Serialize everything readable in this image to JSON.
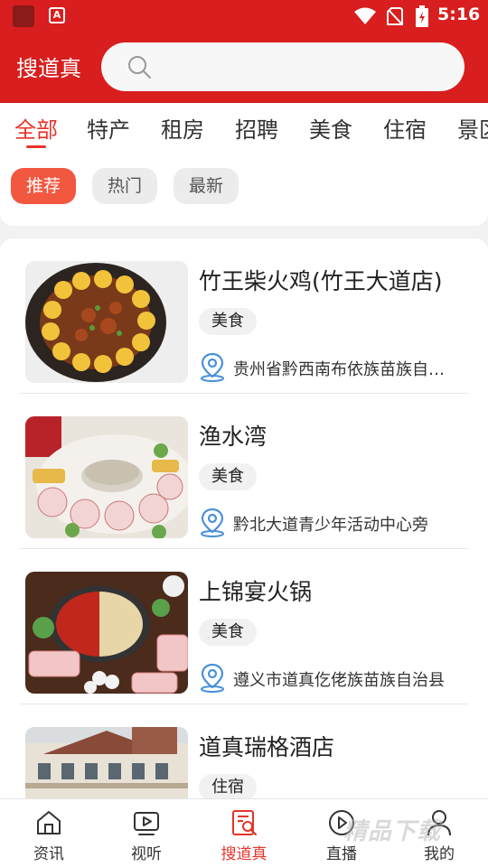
{
  "status_bar": {
    "time": "5:16",
    "notif_glyph": "A"
  },
  "header": {
    "brand": "搜道真",
    "search_placeholder": ""
  },
  "category_tabs": [
    {
      "label": "全部",
      "active": true
    },
    {
      "label": "特产",
      "active": false
    },
    {
      "label": "租房",
      "active": false
    },
    {
      "label": "招聘",
      "active": false
    },
    {
      "label": "美食",
      "active": false
    },
    {
      "label": "住宿",
      "active": false
    },
    {
      "label": "景区",
      "active": false
    }
  ],
  "filters": [
    {
      "label": "推荐",
      "active": true
    },
    {
      "label": "热门",
      "active": false
    },
    {
      "label": "最新",
      "active": false
    }
  ],
  "listings": [
    {
      "title": "竹王柴火鸡(竹王大道店)",
      "tag": "美食",
      "address": "贵州省黔西南布依族苗族自治州"
    },
    {
      "title": "渔水湾",
      "tag": "美食",
      "address": "黔北大道青少年活动中心旁"
    },
    {
      "title": "上锦宴火锅",
      "tag": "美食",
      "address": "遵义市道真仡佬族苗族自治县"
    },
    {
      "title": "道真瑞格酒店",
      "tag": "住宿",
      "address": ""
    }
  ],
  "bottom_nav": [
    {
      "label": "资讯",
      "icon": "home-icon",
      "active": false
    },
    {
      "label": "视听",
      "icon": "video-icon",
      "active": false
    },
    {
      "label": "搜道真",
      "icon": "search-doc-icon",
      "active": true
    },
    {
      "label": "直播",
      "icon": "play-circle-icon",
      "active": false
    },
    {
      "label": "我的",
      "icon": "user-icon",
      "active": false
    }
  ],
  "watermark": "精品下载",
  "colors": {
    "brand_red": "#d81e1e",
    "accent": "#e6342a",
    "chip_active": "#f2573f",
    "pin_blue": "#4a90d9"
  }
}
